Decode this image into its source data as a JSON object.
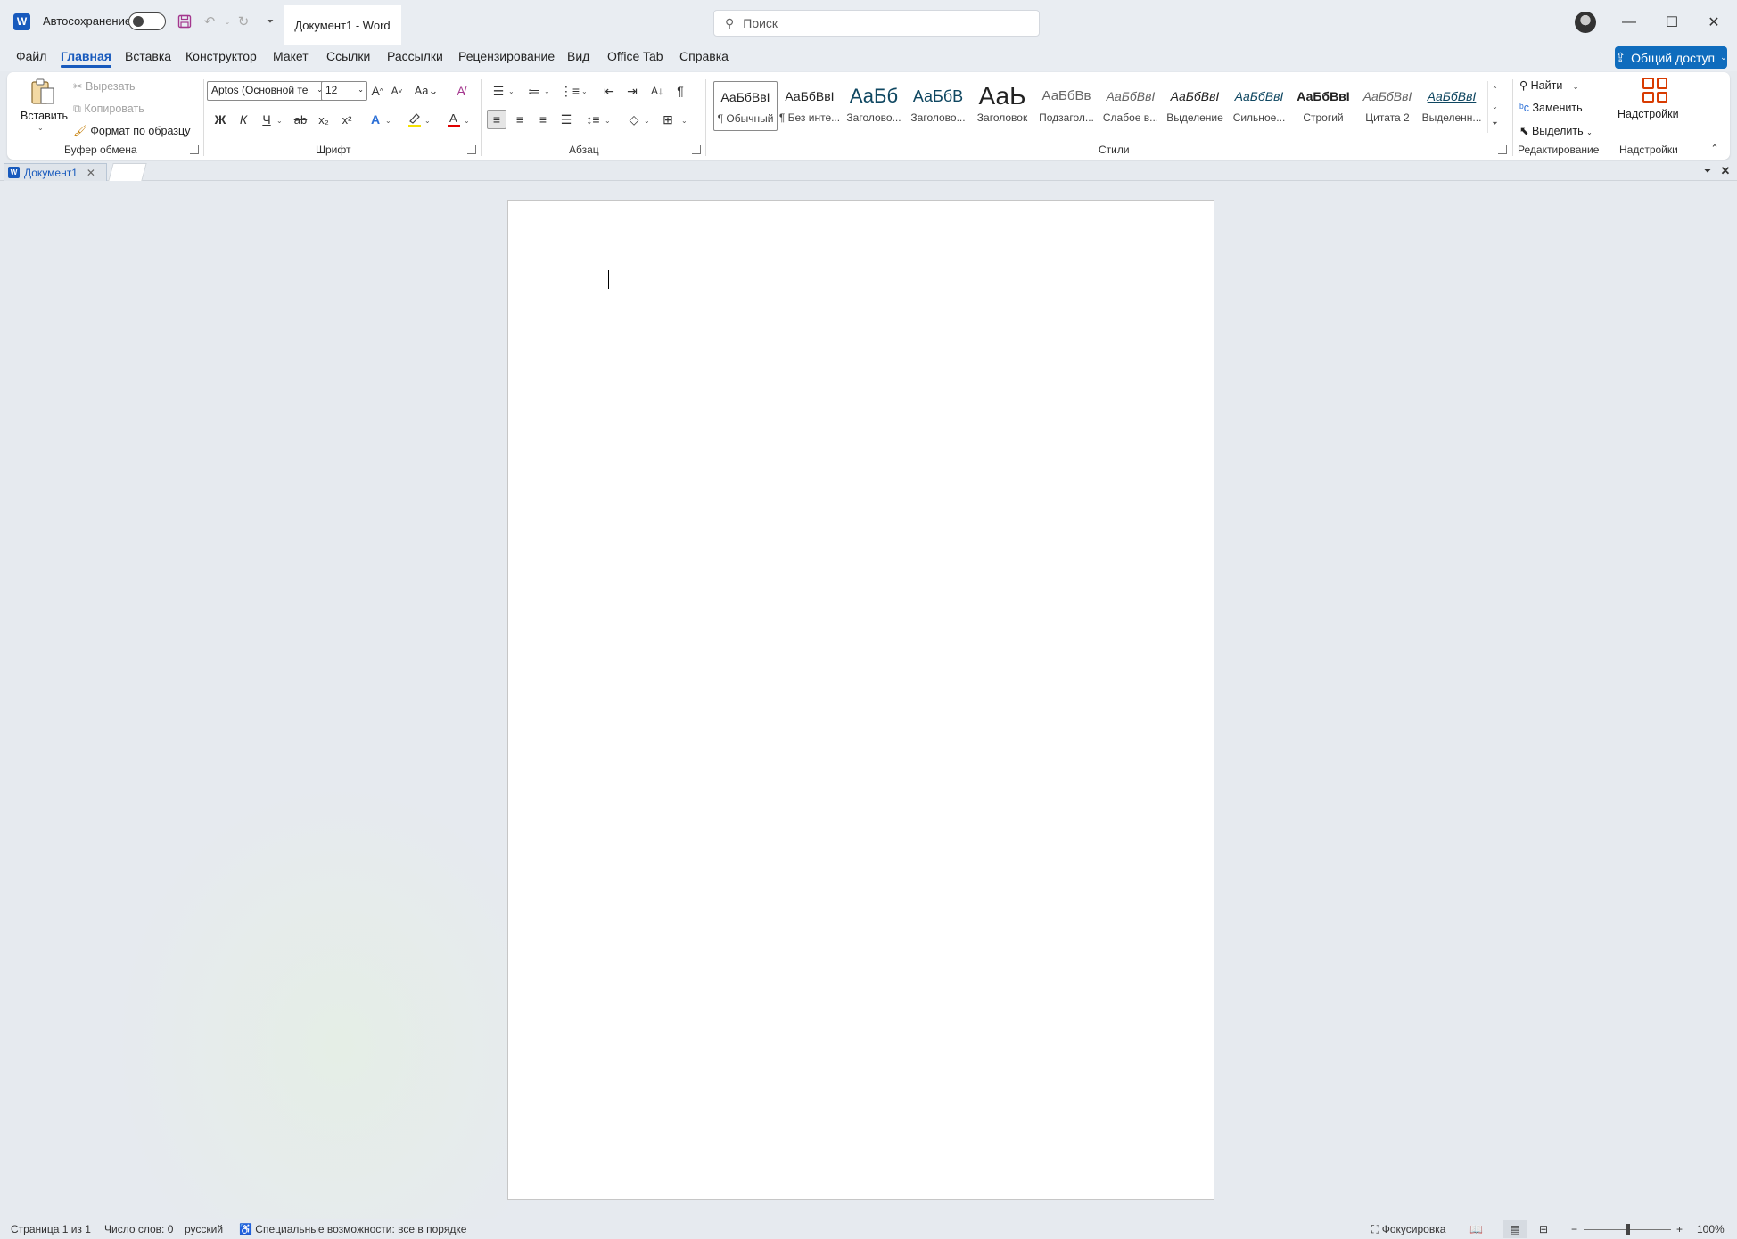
{
  "titlebar": {
    "logo": "W",
    "autosave_label": "Автосохранение",
    "autosave_on": false,
    "doc_title": "Документ1  -  Word",
    "search_placeholder": "Поиск",
    "icons": {
      "save": "save-icon",
      "undo": "undo-icon",
      "redo": "redo-icon",
      "customize": "qat-dropdown-icon",
      "minimize": "minimize-icon",
      "maximize": "maximize-icon",
      "close": "close-icon"
    }
  },
  "menu": {
    "items": [
      "Файл",
      "Главная",
      "Вставка",
      "Конструктор",
      "Макет",
      "Ссылки",
      "Рассылки",
      "Рецензирование",
      "Вид",
      "Office Tab",
      "Справка"
    ],
    "active": "Главная",
    "share_label": "Общий доступ"
  },
  "ribbon": {
    "clipboard": {
      "paste": "Вставить",
      "cut": "Вырезать",
      "copy": "Копировать",
      "format_painter": "Формат по образцу",
      "group_label": "Буфер обмена"
    },
    "font": {
      "font_name": "Aptos (Основной те",
      "font_size": "12",
      "bold": "Ж",
      "italic": "К",
      "underline": "Ч",
      "group_label": "Шрифт"
    },
    "paragraph": {
      "group_label": "Абзац"
    },
    "styles": {
      "group_label": "Стили",
      "items": [
        {
          "sample": "АаБбВвІ",
          "name": "¶ Обычный"
        },
        {
          "sample": "АаБбВвІ",
          "name": "¶ Без инте..."
        },
        {
          "sample": "АаБб",
          "name": "Заголово..."
        },
        {
          "sample": "АаБбВ",
          "name": "Заголово..."
        },
        {
          "sample": "АаЬ",
          "name": "Заголовок"
        },
        {
          "sample": "АаБбВв",
          "name": "Подзагол..."
        },
        {
          "sample": "АаБбВвІ",
          "name": "Слабое в..."
        },
        {
          "sample": "АаБбВвІ",
          "name": "Выделение"
        },
        {
          "sample": "АаБбВвІ",
          "name": "Сильное..."
        },
        {
          "sample": "АаБбВвІ",
          "name": "Строгий"
        },
        {
          "sample": "АаБбВвІ",
          "name": "Цитата 2"
        },
        {
          "sample": "АаБбВвІ",
          "name": "Выделенн..."
        }
      ]
    },
    "editing": {
      "find": "Найти",
      "replace": "Заменить",
      "select": "Выделить",
      "group_label": "Редактирование"
    },
    "addins": {
      "button": "Надстройки",
      "group_label": "Надстройки"
    }
  },
  "tabs": {
    "doc_tab": "Документ1"
  },
  "status": {
    "page": "Страница 1 из 1",
    "words": "Число слов: 0",
    "language": "русский",
    "accessibility": "Специальные возможности: все в порядке",
    "focus": "Фокусировка",
    "zoom": "100%"
  }
}
